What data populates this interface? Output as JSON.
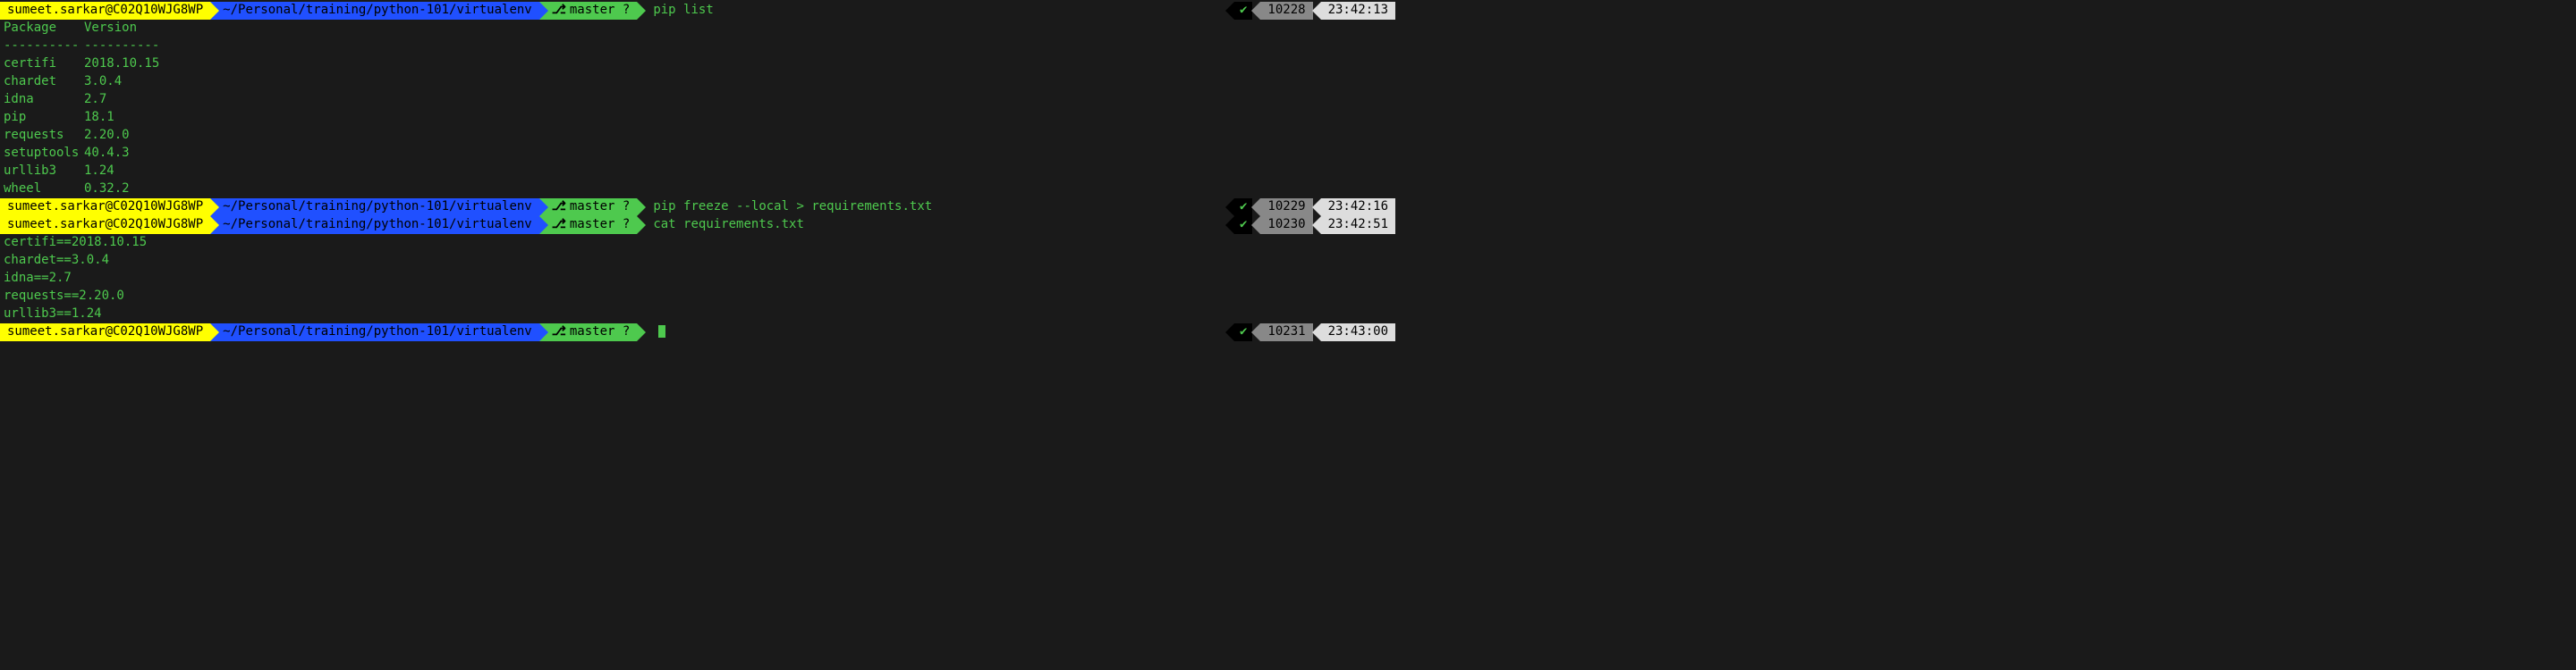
{
  "user_host": "sumeet.sarkar@C02Q10WJG8WP",
  "path": "~/Personal/training/python-101/virtualenv",
  "branch_label": "master ?",
  "prompts": [
    {
      "cmd": "pip list",
      "num": "10228",
      "time": "23:42:13"
    },
    {
      "cmd": "pip freeze --local > requirements.txt",
      "num": "10229",
      "time": "23:42:16"
    },
    {
      "cmd": "cat requirements.txt",
      "num": "10230",
      "time": "23:42:51"
    },
    {
      "cmd": "",
      "num": "10231",
      "time": "23:43:00"
    }
  ],
  "pip_list_header": {
    "c1": "Package",
    "c2": "Version"
  },
  "pip_list_divider": {
    "c1": "----------",
    "c2": "----------"
  },
  "pip_list_rows": [
    {
      "c1": "certifi",
      "c2": "2018.10.15"
    },
    {
      "c1": "chardet",
      "c2": "3.0.4"
    },
    {
      "c1": "idna",
      "c2": "2.7"
    },
    {
      "c1": "pip",
      "c2": "18.1"
    },
    {
      "c1": "requests",
      "c2": "2.20.0"
    },
    {
      "c1": "setuptools",
      "c2": "40.4.3"
    },
    {
      "c1": "urllib3",
      "c2": "1.24"
    },
    {
      "c1": "wheel",
      "c2": "0.32.2"
    }
  ],
  "freeze_output": [
    "certifi==2018.10.15",
    "chardet==3.0.4",
    "idna==2.7",
    "requests==2.20.0",
    "urllib3==1.24"
  ],
  "check": "✔"
}
